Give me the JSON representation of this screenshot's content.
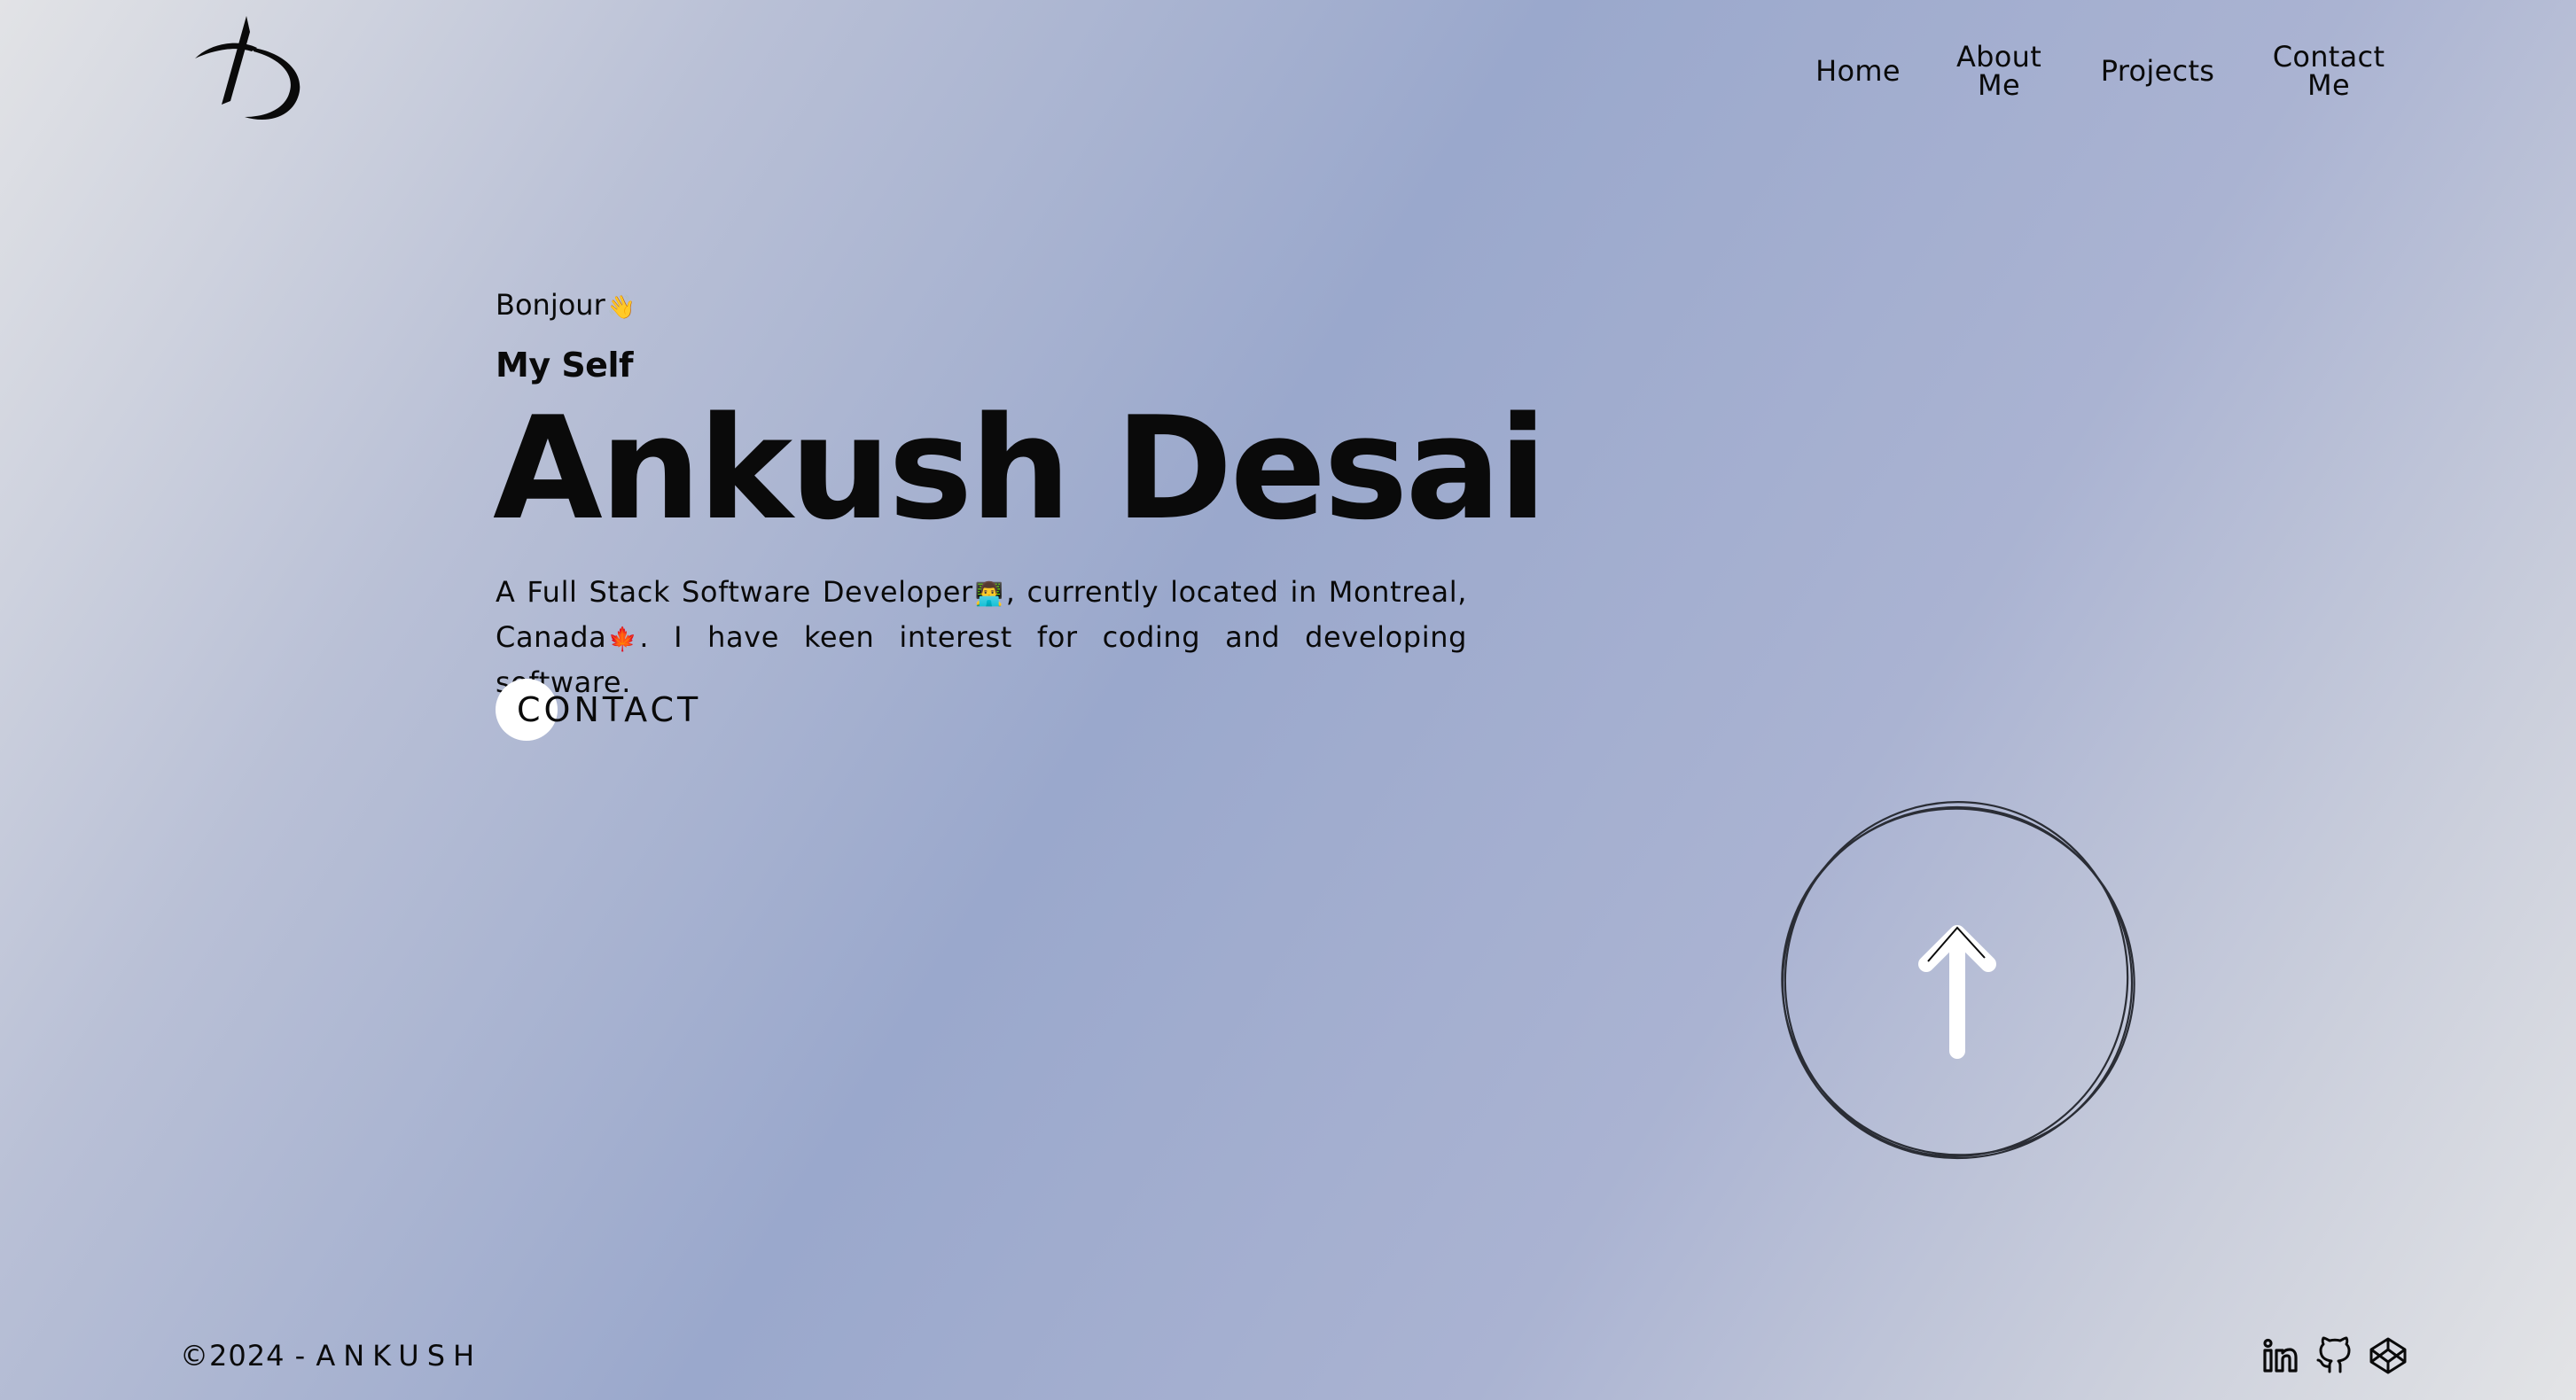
{
  "nav": {
    "items": [
      {
        "label": "Home"
      },
      {
        "label": "About\nMe"
      },
      {
        "label": "Projects"
      },
      {
        "label": "Contact\nMe"
      }
    ]
  },
  "hero": {
    "greeting": "Bonjour",
    "greeting_emoji": "👋",
    "subtitle": "My Self",
    "name": "Ankush Desai",
    "bio_part1": "A Full Stack Software Developer",
    "bio_emoji1": "👨‍💻",
    "bio_part2": ", currently located in Montreal, Canada",
    "bio_emoji2": "🍁",
    "bio_part3": ". I have keen interest for coding and developing software.",
    "contact_label": "CONTACT"
  },
  "footer": {
    "copyright_prefix": "©2024 - ",
    "brand": "ANKUSH"
  },
  "icons": {
    "logo": "logo-icon",
    "scroll_top": "arrow-up-icon",
    "social": [
      "linkedin-icon",
      "github-icon",
      "codepen-icon"
    ]
  },
  "colors": {
    "text": "#0a0a0a",
    "accent_white": "#ffffff",
    "bg_light": "#e2e3e6",
    "bg_blue": "#9aa8cc"
  }
}
